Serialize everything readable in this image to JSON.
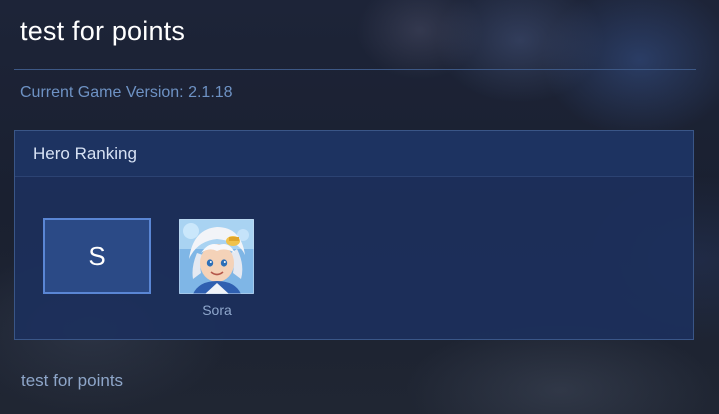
{
  "page": {
    "title": "test for points",
    "version_text": "Current Game Version: 2.1.18",
    "footer_text": "test for points"
  },
  "ranking": {
    "header": "Hero Ranking",
    "tiers": [
      {
        "label": "S",
        "heroes": [
          {
            "name": "Sora",
            "icon": "sora-portrait-icon"
          }
        ]
      }
    ]
  },
  "colors": {
    "background": "#1b2233",
    "panel": "#1c305c",
    "panel_border": "#3a5687",
    "tier_box": "#2b4a86",
    "tier_border": "#5a86d4",
    "accent_text": "#6e92c4",
    "muted_text": "#8fa7cc"
  }
}
